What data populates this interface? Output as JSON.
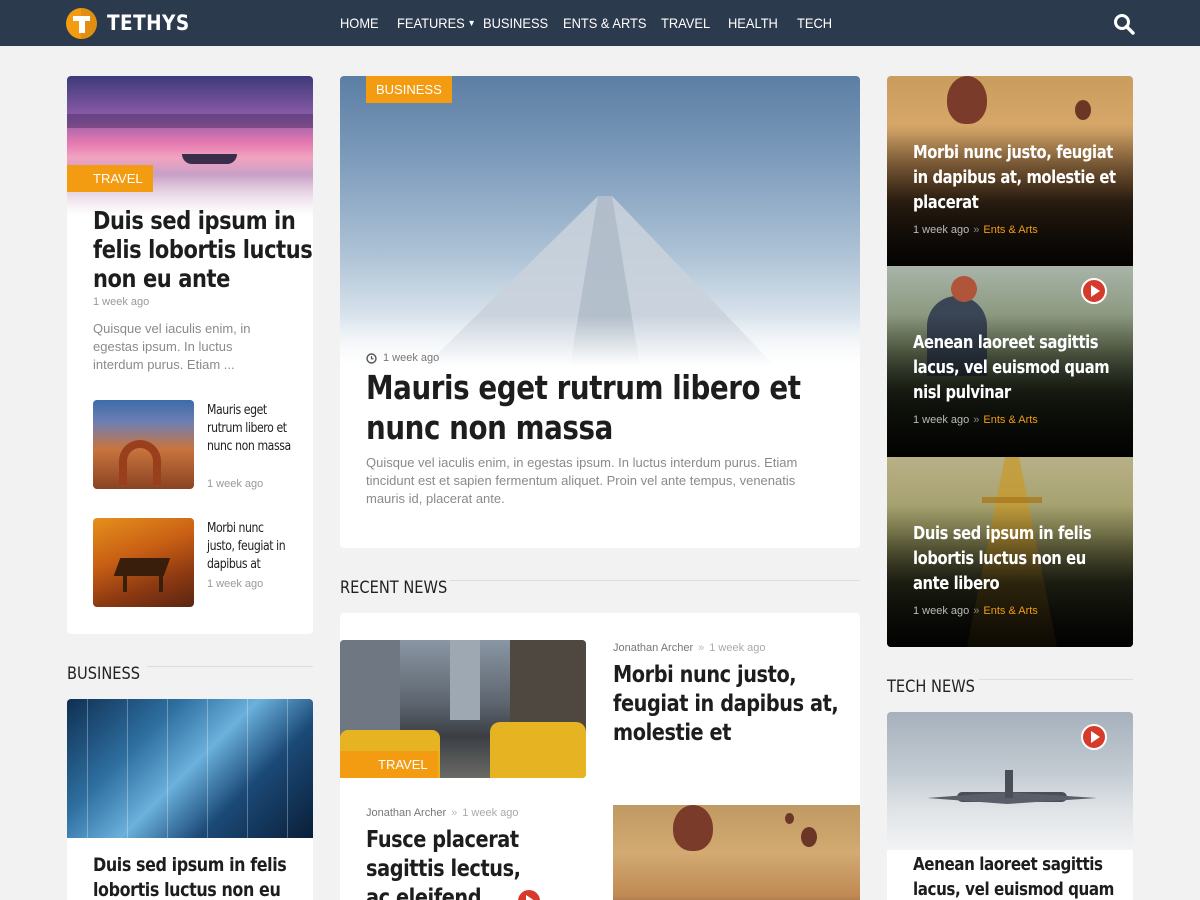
{
  "brand": {
    "name": "TETHYS"
  },
  "nav": {
    "items": [
      "HOME",
      "FEATURES",
      "BUSINESS",
      "ENTS & ARTS",
      "TRAVEL",
      "HEALTH",
      "TECH"
    ],
    "features_has_dropdown": true
  },
  "colors": {
    "accent": "#f39c12",
    "nav_bg": "#2c3a4d",
    "play": "#d63a2a"
  },
  "left_column": {
    "featured": {
      "tag": "TRAVEL",
      "title": "Duis sed ipsum in felis lobortis luctus non eu ante",
      "date": "1 week ago",
      "excerpt": "Quisque vel iaculis enim, in egestas ipsum. In luctus interdum purus. Etiam ..."
    },
    "small_posts": [
      {
        "title": "Mauris eget rutrum libero et nunc non massa",
        "date": "1 week ago"
      },
      {
        "title": "Morbi nunc justo, feugiat in dapibus at",
        "date": "1 week ago"
      }
    ],
    "business_section": {
      "heading": "BUSINESS",
      "post_title": "Duis sed ipsum in felis lobortis luctus non eu"
    }
  },
  "center_column": {
    "hero": {
      "tag": "BUSINESS",
      "date": "1 week ago",
      "title": "Mauris eget rutrum libero et nunc non massa",
      "excerpt": "Quisque vel iaculis enim, in egestas ipsum. In luctus interdum purus. Etiam tincidunt est et sapien fermentum aliquet. Proin vel ante tempus, venenatis mauris id, placerat ante."
    },
    "recent_news": {
      "heading": "RECENT NEWS",
      "post1": {
        "tag": "TRAVEL",
        "author": "Jonathan Archer",
        "date": "1 week ago",
        "title": "Morbi nunc justo, feugiat in dapibus at, molestie et"
      },
      "post2": {
        "author": "Jonathan Archer",
        "date": "1 week ago",
        "title": "Fusce placerat sagittis lectus, ac eleifend neque"
      }
    }
  },
  "right_column": {
    "overlay_posts": [
      {
        "title": "Morbi nunc justo, feugiat in dapibus at, molestie et placerat",
        "date": "1 week ago",
        "category": "Ents & Arts"
      },
      {
        "title": "Aenean laoreet sagittis lacus, vel euismod quam nisl pulvinar",
        "date": "1 week ago",
        "category": "Ents & Arts",
        "video": true
      },
      {
        "title": "Duis sed ipsum in felis lobortis luctus non eu ante libero",
        "date": "1 week ago",
        "category": "Ents & Arts"
      }
    ],
    "tech_news": {
      "heading": "TECH NEWS",
      "post_title": "Aenean laoreet sagittis lacus, vel euismod quam",
      "video": true
    }
  },
  "icons": {
    "logo": "tethys-logo-icon",
    "search": "search-icon",
    "clock": "clock-icon",
    "play": "play-icon",
    "dropdown": "chevron-down-icon"
  }
}
